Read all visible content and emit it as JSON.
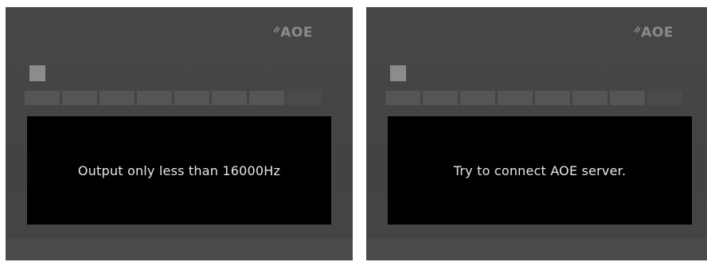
{
  "screens": [
    {
      "brand_logo": "AOE",
      "brand_icon": "signal-wave-icon",
      "level_meter": {
        "segments_total": 8,
        "segments_lit": 7
      },
      "message": "Output only less than 16000Hz"
    },
    {
      "brand_logo": "AOE",
      "brand_icon": "signal-wave-icon",
      "level_meter": {
        "segments_total": 8,
        "segments_lit": 7
      },
      "message": "Try to connect AOE server."
    }
  ],
  "colors": {
    "panel_background": "#454545",
    "message_background": "#000000",
    "message_text": "#e8e8e8",
    "logo": "#8a8a8a",
    "indicator": "#8c8c8c"
  }
}
